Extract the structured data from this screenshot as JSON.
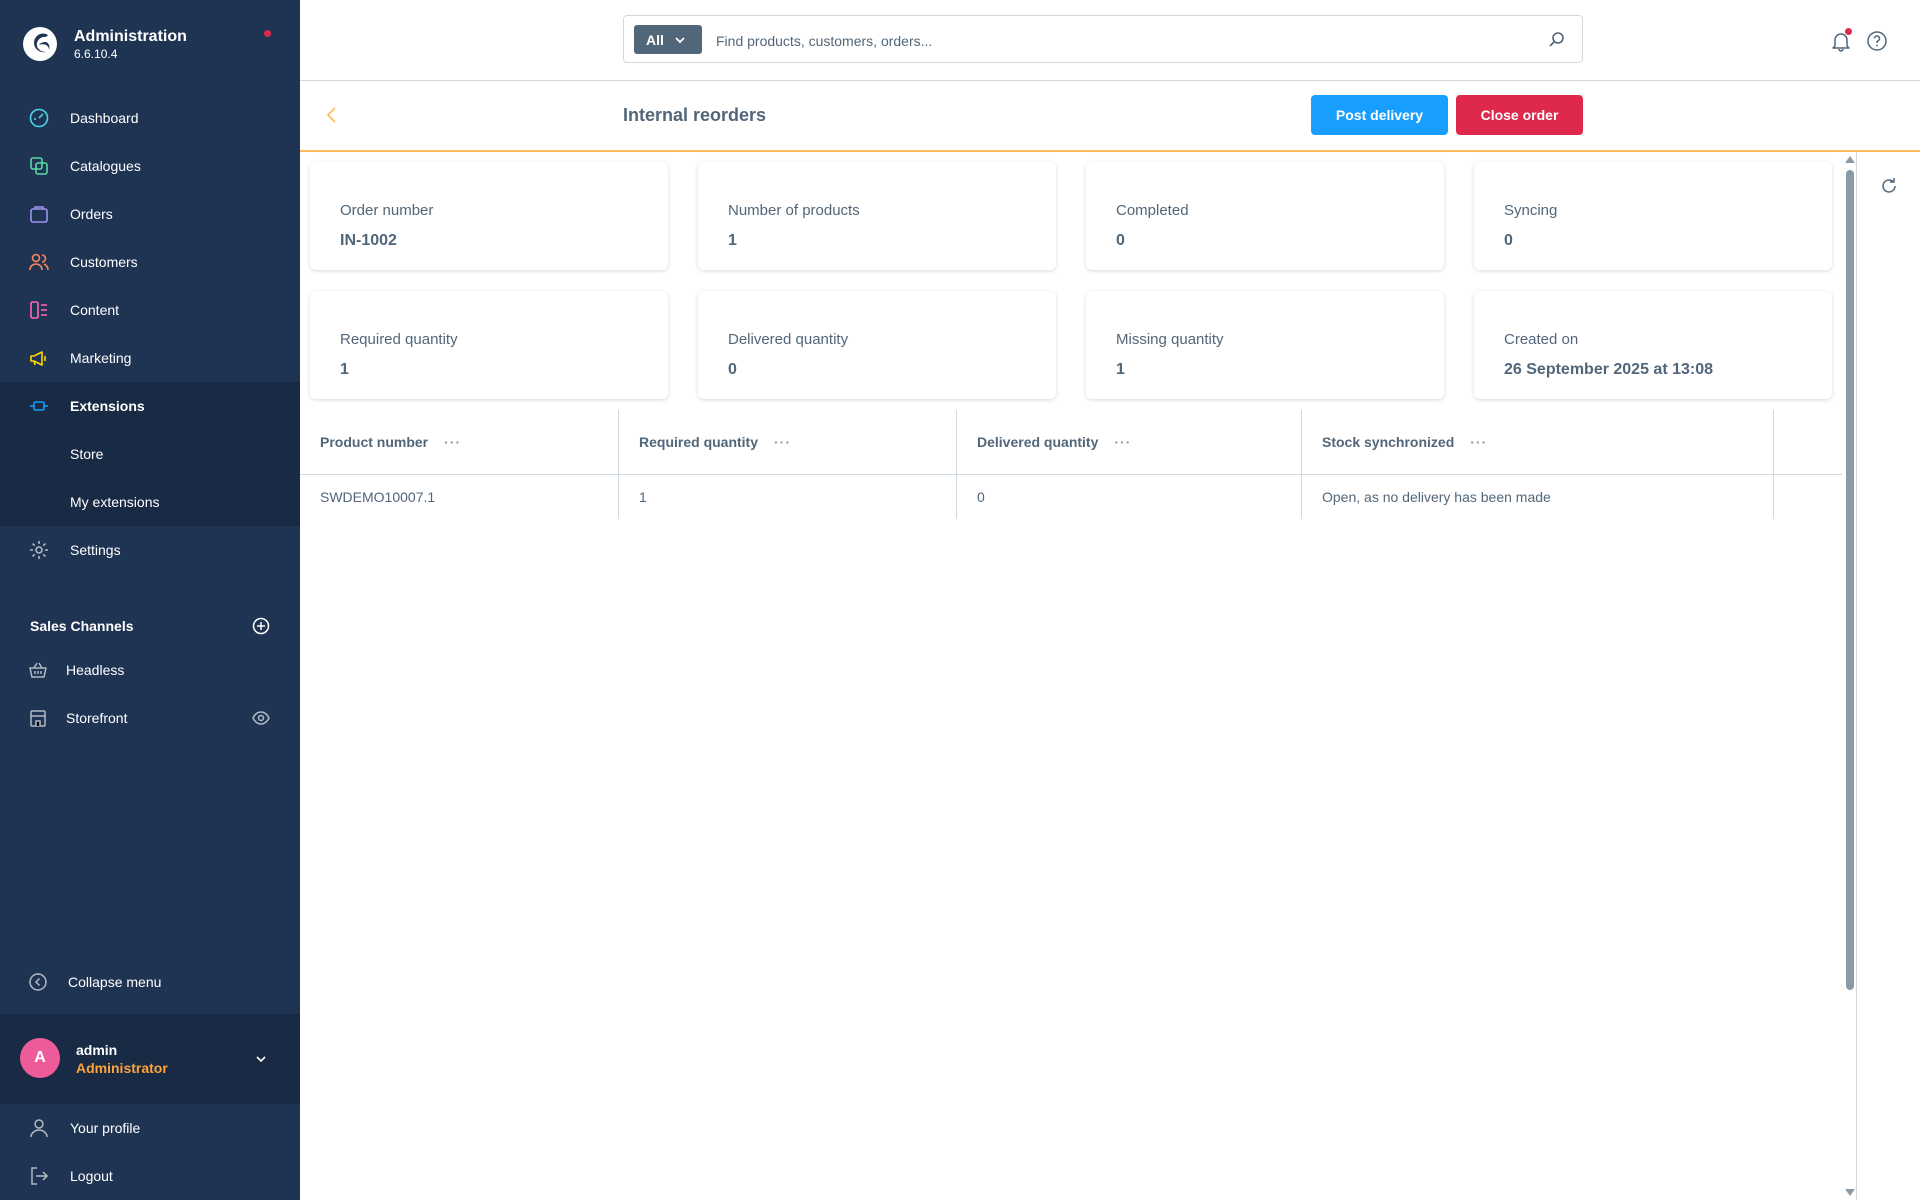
{
  "brand": {
    "title": "Administration",
    "version": "6.6.10.4"
  },
  "nav": {
    "dashboard": "Dashboard",
    "catalogues": "Catalogues",
    "orders": "Orders",
    "customers": "Customers",
    "content": "Content",
    "marketing": "Marketing",
    "extensions": "Extensions",
    "store": "Store",
    "my_extensions": "My extensions",
    "settings": "Settings"
  },
  "sales_channels": {
    "title": "Sales Channels",
    "items": [
      "Headless",
      "Storefront"
    ]
  },
  "collapse_label": "Collapse menu",
  "user": {
    "initial": "A",
    "name": "admin",
    "role": "Administrator",
    "menu": [
      "Your profile",
      "Logout"
    ]
  },
  "search": {
    "type_label": "All",
    "placeholder": "Find products, customers, orders..."
  },
  "smartbar": {
    "title": "Internal reorders",
    "post_delivery": "Post delivery",
    "close_order": "Close order"
  },
  "cards": [
    {
      "label": "Order number",
      "value": "IN-1002"
    },
    {
      "label": "Number of products",
      "value": "1"
    },
    {
      "label": "Completed",
      "value": "0"
    },
    {
      "label": "Syncing",
      "value": "0"
    },
    {
      "label": "Required quantity",
      "value": "1"
    },
    {
      "label": "Delivered quantity",
      "value": "0"
    },
    {
      "label": "Missing quantity",
      "value": "1"
    },
    {
      "label": "Created on",
      "value": "26 September 2025 at 13:08"
    }
  ],
  "table": {
    "columns": [
      "Product number",
      "Required quantity",
      "Delivered quantity",
      "Stock synchronized"
    ],
    "rows": [
      [
        "SWDEMO10007.1",
        "1",
        "0",
        "Open, as no delivery has been made"
      ]
    ]
  },
  "colors": {
    "sidebar": "#1f3453",
    "sidebar_active": "#182a44",
    "primary": "#189eff",
    "danger": "#de294c",
    "accent_border": "#ffbd5d",
    "role": "#ffa33a",
    "avatar": "#ed5b9a"
  }
}
